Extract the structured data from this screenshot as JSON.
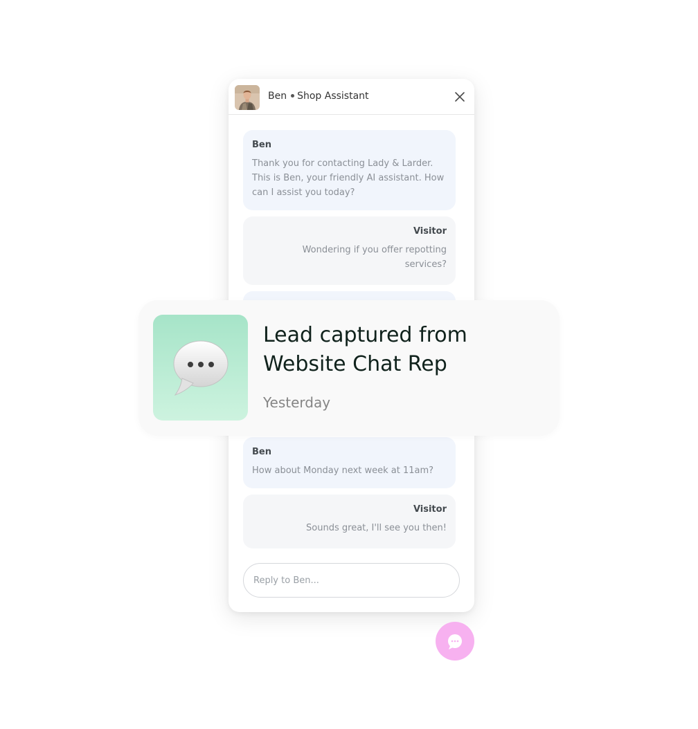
{
  "chat": {
    "agent_name": "Ben",
    "agent_role": "Shop Assistant",
    "messages": [
      {
        "sender": "Ben",
        "text": "Thank you for contacting Lady & Larder. This is Ben, your friendly AI assistant. How can I assist you today?"
      },
      {
        "sender": "Visitor",
        "text": "Wondering if you offer repotting services?"
      },
      {
        "sender": "Ben",
        "text": "How about Monday next week at 11am?"
      },
      {
        "sender": "Visitor",
        "text": "Sounds great, I'll see you then!"
      }
    ],
    "reply_placeholder": "Reply to Ben..."
  },
  "lead_card": {
    "title": "Lead captured from Website Chat Rep",
    "time": "Yesterday",
    "icon": "speech-bubble-icon"
  },
  "launcher": {
    "icon": "chat-bubble-icon"
  },
  "icons": {
    "close": "close-icon",
    "avatar": "avatar"
  },
  "colors": {
    "launcher": "#f7b1f0",
    "agent_bubble": "#f1f5fc",
    "visitor_bubble": "#f5f6f8",
    "lead_tile_top": "#a6e4c8",
    "lead_tile_bottom": "#cdf3df",
    "lead_title": "#10221c"
  }
}
